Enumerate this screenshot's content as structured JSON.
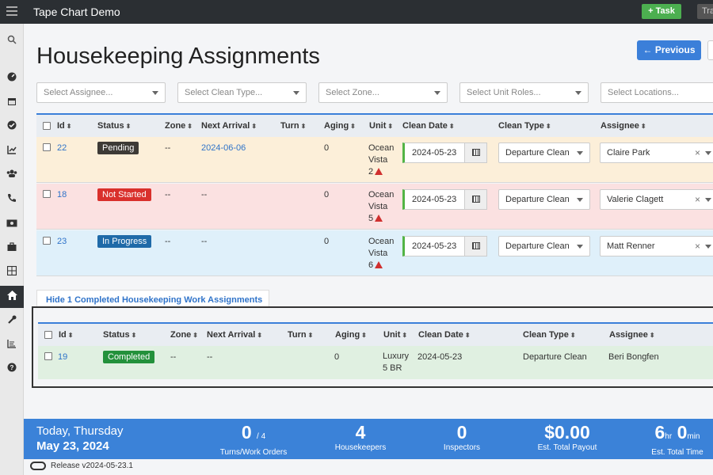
{
  "app": {
    "title": "Tape Chart Demo",
    "task_label": "+ Task",
    "tr_label": "Tra"
  },
  "page": {
    "title": "Housekeeping Assignments",
    "previous_label": "← Previous"
  },
  "filters": [
    "Select Assignee...",
    "Select Clean Type...",
    "Select Zone...",
    "Select Unit Roles...",
    "Select Locations..."
  ],
  "columns": [
    "Id",
    "Status",
    "Zone",
    "Next Arrival",
    "Turn",
    "Aging",
    "Unit",
    "Clean Date",
    "Clean Type",
    "Assignee"
  ],
  "rows": [
    {
      "id": "22",
      "status": "Pending",
      "status_color": "#3d3a36",
      "zone": "--",
      "next_arrival": "2024-06-06",
      "turn": "",
      "aging": "0",
      "unit_l1": "Ocean",
      "unit_l2": "Vista",
      "unit_l3": "2",
      "clean_date": "2024-05-23",
      "clean_type": "Departure Clean",
      "assignee": "Claire Park",
      "bg": "#fcefd9"
    },
    {
      "id": "18",
      "status": "Not Started",
      "status_color": "#d9302c",
      "zone": "--",
      "next_arrival": "--",
      "turn": "",
      "aging": "0",
      "unit_l1": "Ocean",
      "unit_l2": "Vista",
      "unit_l3": "5",
      "clean_date": "2024-05-23",
      "clean_type": "Departure Clean",
      "assignee": "Valerie Clagett",
      "bg": "#fbe1e1"
    },
    {
      "id": "23",
      "status": "In Progress",
      "status_color": "#1f6aa8",
      "zone": "--",
      "next_arrival": "--",
      "turn": "",
      "aging": "0",
      "unit_l1": "Ocean",
      "unit_l2": "Vista",
      "unit_l3": "6",
      "clean_date": "2024-05-23",
      "clean_type": "Departure Clean",
      "assignee": "Matt Renner",
      "bg": "#dff0fa"
    }
  ],
  "completed_toggle": "Hide 1 Completed Housekeeping Work Assignments",
  "completed_rows": [
    {
      "id": "19",
      "status": "Completed",
      "status_color": "#23913b",
      "zone": "--",
      "next_arrival": "--",
      "turn": "",
      "aging": "0",
      "unit_l1": "Luxury",
      "unit_l2": "5 BR",
      "clean_date": "2024-05-23",
      "clean_type": "Departure Clean",
      "assignee": "Beri Bongfen"
    }
  ],
  "footer": {
    "day": "Today, Thursday",
    "date": "May 23, 2024",
    "turns": {
      "value": "0",
      "total": "/ 4",
      "label": "Turns/Work Orders"
    },
    "housekeepers": {
      "value": "4",
      "label": "Housekeepers"
    },
    "inspectors": {
      "value": "0",
      "label": "Inspectors"
    },
    "payout": {
      "value": "$0.00",
      "label": "Est. Total Payout"
    },
    "time": {
      "hours": "6",
      "hr_unit": "hr",
      "mins": "0",
      "min_unit": "min",
      "label": "Est. Total Time"
    }
  },
  "release": "Release v2024-05-23.1"
}
